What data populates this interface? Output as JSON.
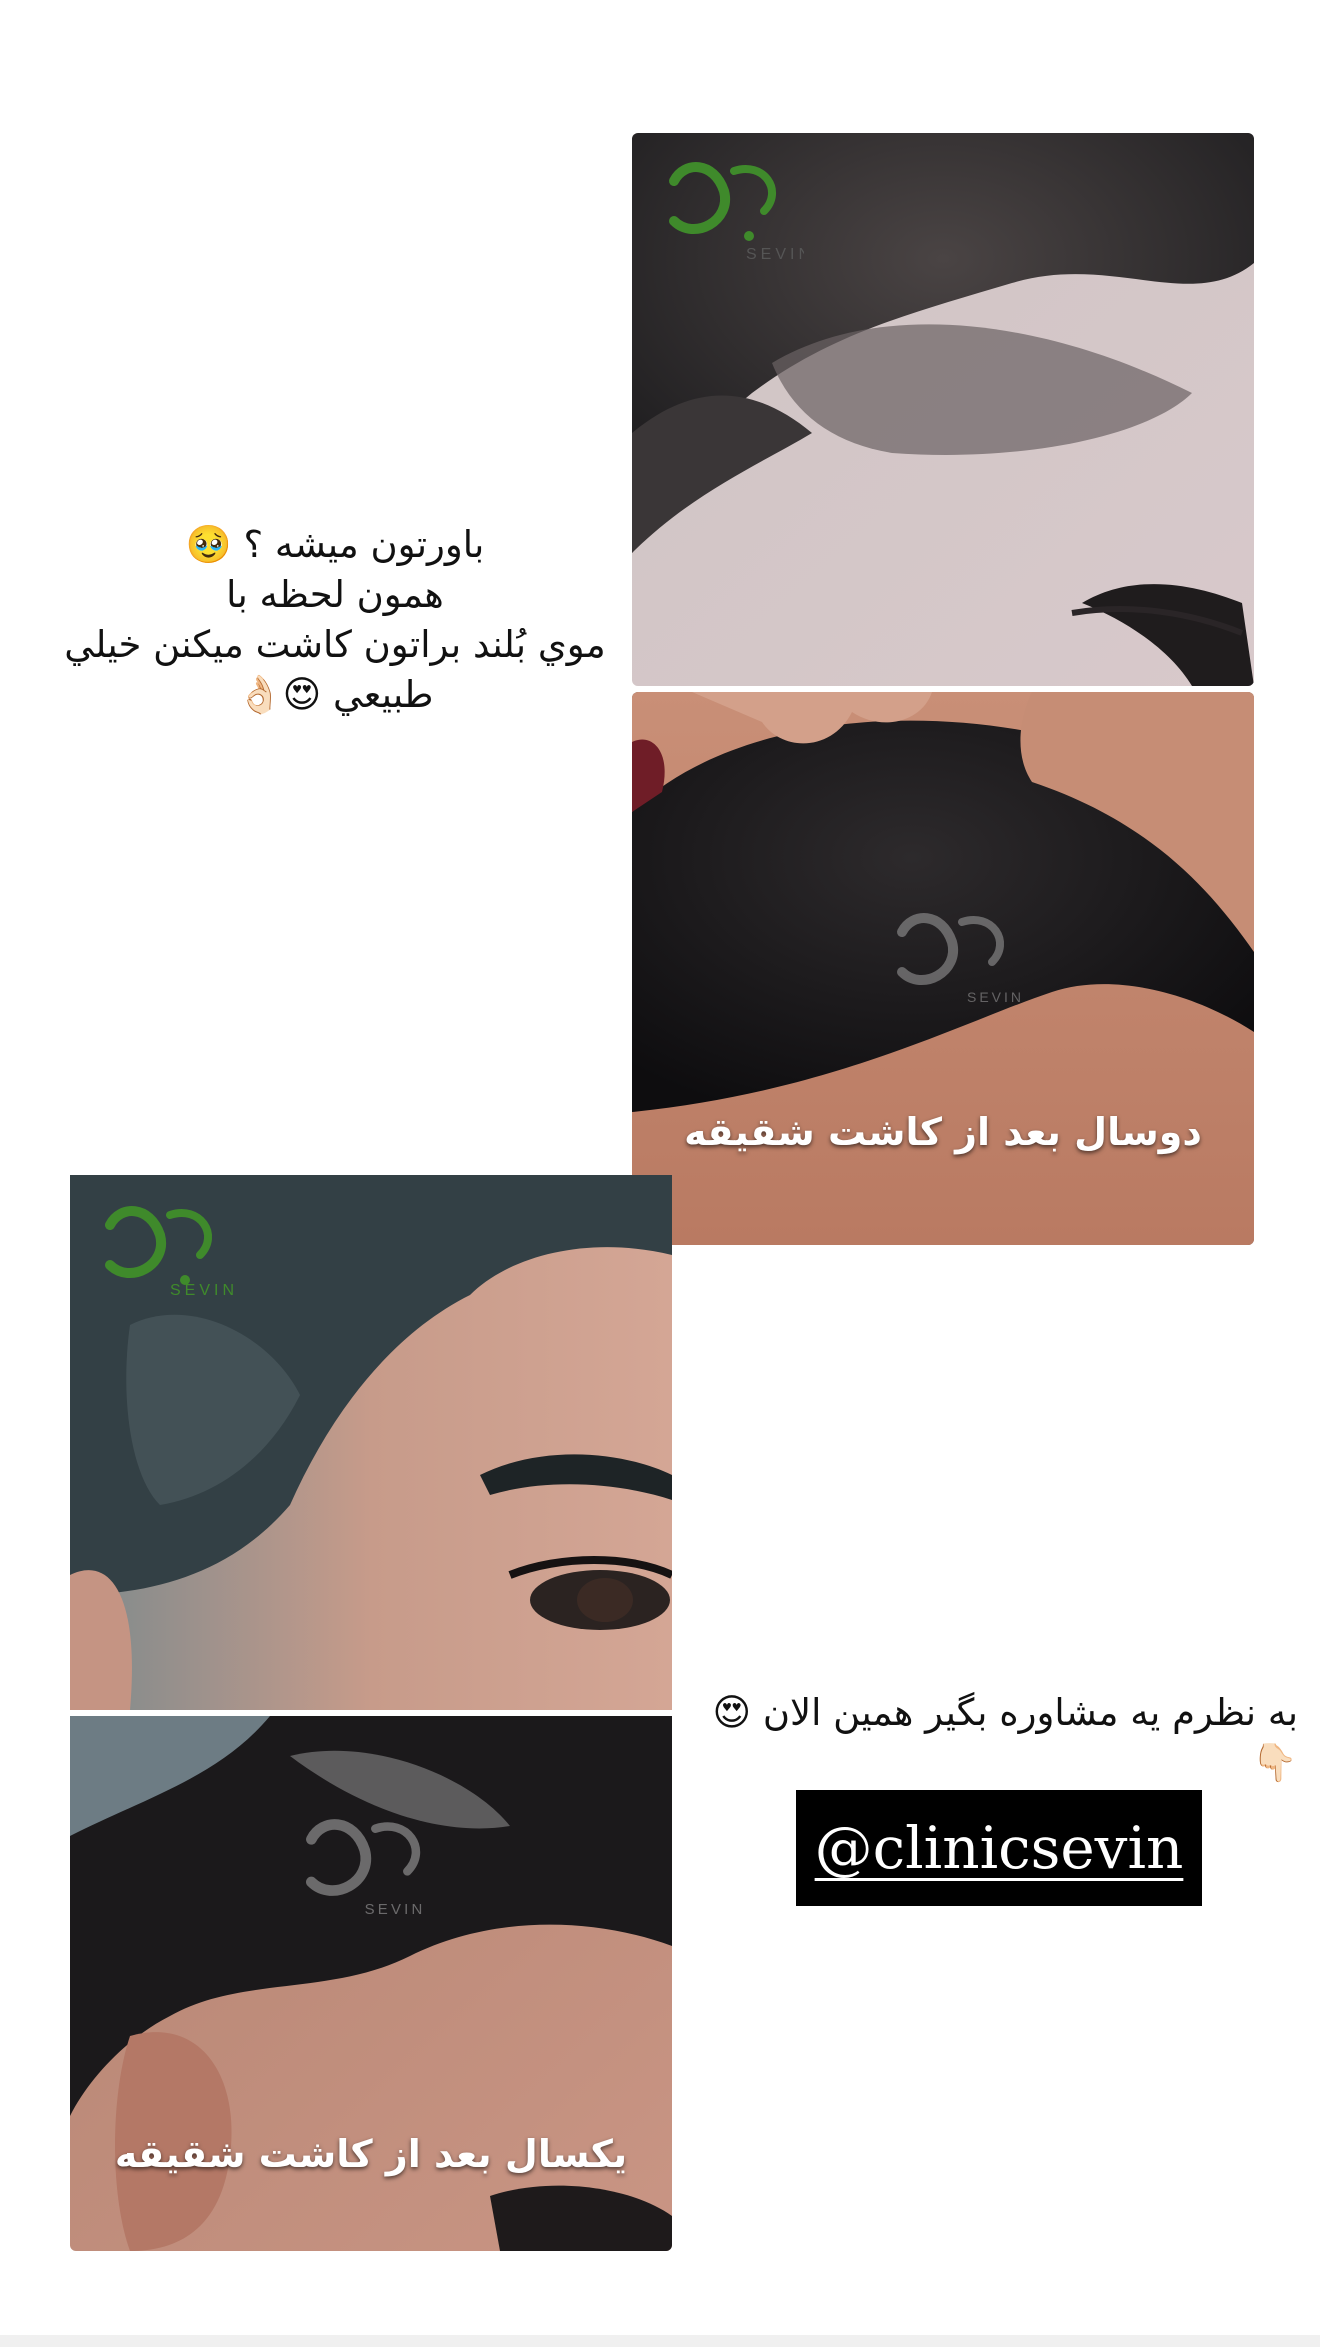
{
  "top_text": {
    "line1": "باورتون ميشه ؟",
    "line1_emoji": "🥹",
    "line2": "همون لحظه با",
    "line3": "موي بُلند براتون كاشت ميكنن خيلي",
    "line4": "طبيعي",
    "line4_emoji": "😍👌🏻"
  },
  "photos": {
    "top_before": {
      "logo_text": "SEVIN"
    },
    "top_after": {
      "caption": "دوسال بعد از كاشت شقيقه",
      "logo_text": "SEVIN"
    },
    "bottom_before": {
      "logo_text": "SEVIN"
    },
    "bottom_after": {
      "caption": "يكسال بعد از كاشت شقيقه",
      "logo_text": "SEVIN"
    }
  },
  "cta_text": {
    "text": "به نظرم يه مشاوره بگير همين الان",
    "emoji": "😍👇🏻"
  },
  "handle": {
    "text": "@clinicsevin"
  },
  "colors": {
    "logo_green": "#3f8a2b",
    "background": "#ffffff",
    "handle_bg": "#000000"
  }
}
